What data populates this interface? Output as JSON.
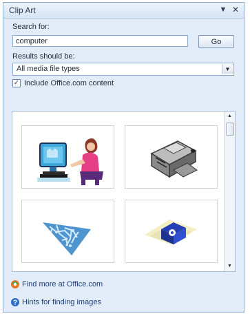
{
  "pane": {
    "title": "Clip Art",
    "dropdown_icon": "triangle-down-icon",
    "close_icon": "close-icon"
  },
  "search": {
    "label": "Search for:",
    "value": "computer",
    "go_label": "Go"
  },
  "results": {
    "label": "Results should be:",
    "selected": "All media file types"
  },
  "include_office": {
    "label": "Include Office.com content",
    "checked": true
  },
  "gallery": {
    "items": [
      {
        "icon": "person-at-computer-clipart"
      },
      {
        "icon": "computer-hardware-clipart"
      },
      {
        "icon": "circuit-triangle-clipart"
      },
      {
        "icon": "floppy-disk-clipart"
      }
    ]
  },
  "links": {
    "find_more": "Find more at Office.com",
    "hints": "Hints for finding images"
  },
  "colors": {
    "pane_background": "#e2ecf8",
    "link": "#1f3f7a"
  }
}
